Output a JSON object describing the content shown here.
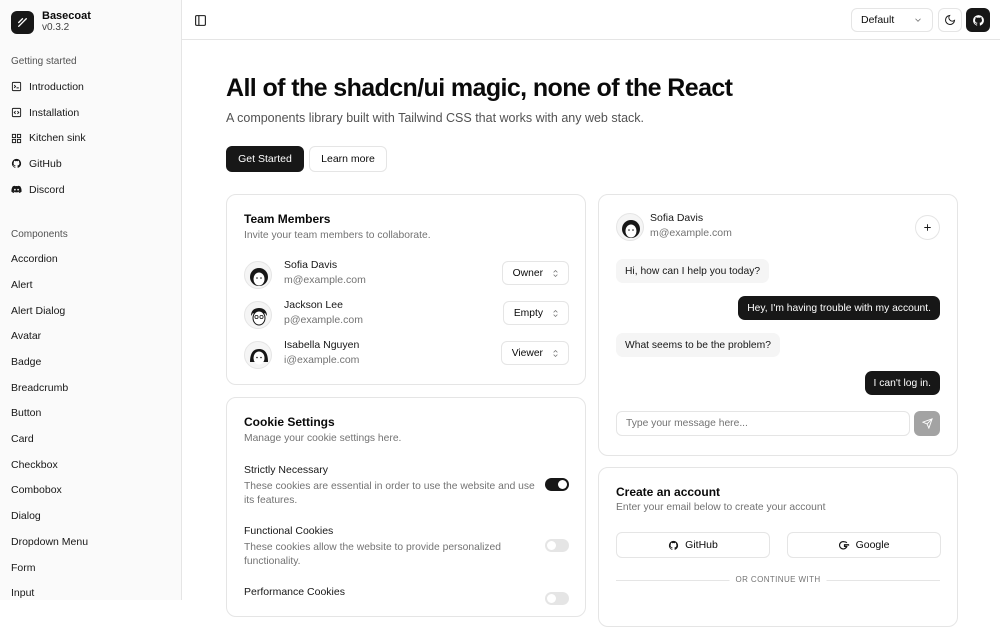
{
  "brand": {
    "name": "Basecoat",
    "version": "v0.3.2"
  },
  "sidebar": {
    "groups": [
      {
        "label": "Getting started",
        "items": [
          {
            "label": "Introduction",
            "icon": "square-terminal-icon"
          },
          {
            "label": "Installation",
            "icon": "code-icon"
          },
          {
            "label": "Kitchen sink",
            "icon": "grid-icon"
          },
          {
            "label": "GitHub",
            "icon": "github-icon"
          },
          {
            "label": "Discord",
            "icon": "discord-icon"
          }
        ]
      },
      {
        "label": "Components",
        "items": [
          {
            "label": "Accordion"
          },
          {
            "label": "Alert"
          },
          {
            "label": "Alert Dialog"
          },
          {
            "label": "Avatar"
          },
          {
            "label": "Badge"
          },
          {
            "label": "Breadcrumb"
          },
          {
            "label": "Button"
          },
          {
            "label": "Card"
          },
          {
            "label": "Checkbox"
          },
          {
            "label": "Combobox"
          },
          {
            "label": "Dialog"
          },
          {
            "label": "Dropdown Menu"
          },
          {
            "label": "Form"
          },
          {
            "label": "Input"
          }
        ]
      }
    ]
  },
  "header": {
    "theme_select": "Default"
  },
  "hero": {
    "title": "All of the shadcn/ui magic, none of the React",
    "subtitle": "A components library built with Tailwind CSS that works with any web stack.",
    "primary_button": "Get Started",
    "secondary_button": "Learn more"
  },
  "team": {
    "title": "Team Members",
    "description": "Invite your team members to collaborate.",
    "members": [
      {
        "name": "Sofia Davis",
        "email": "m@example.com",
        "role": "Owner"
      },
      {
        "name": "Jackson Lee",
        "email": "p@example.com",
        "role": "Empty"
      },
      {
        "name": "Isabella Nguyen",
        "email": "i@example.com",
        "role": "Viewer"
      }
    ]
  },
  "cookies": {
    "title": "Cookie Settings",
    "description": "Manage your cookie settings here.",
    "items": [
      {
        "name": "Strictly Necessary",
        "description": "These cookies are essential in order to use the website and use its features.",
        "enabled": true
      },
      {
        "name": "Functional Cookies",
        "description": "These cookies allow the website to provide personalized functionality.",
        "enabled": false
      },
      {
        "name": "Performance Cookies",
        "description": "",
        "enabled": false
      }
    ]
  },
  "chat": {
    "user_name": "Sofia Davis",
    "user_email": "m@example.com",
    "messages": [
      {
        "from": "in",
        "text": "Hi, how can I help you today?"
      },
      {
        "from": "out",
        "text": "Hey, I'm having trouble with my account."
      },
      {
        "from": "in",
        "text": "What seems to be the problem?"
      },
      {
        "from": "out",
        "text": "I can't log in."
      }
    ],
    "input_placeholder": "Type your message here..."
  },
  "account": {
    "title": "Create an account",
    "description": "Enter your email below to create your account",
    "github_button": "GitHub",
    "google_button": "Google",
    "divider": "OR CONTINUE WITH"
  },
  "colors": {
    "primary": "#171717",
    "muted": "#737373",
    "border": "#e5e5e5"
  }
}
